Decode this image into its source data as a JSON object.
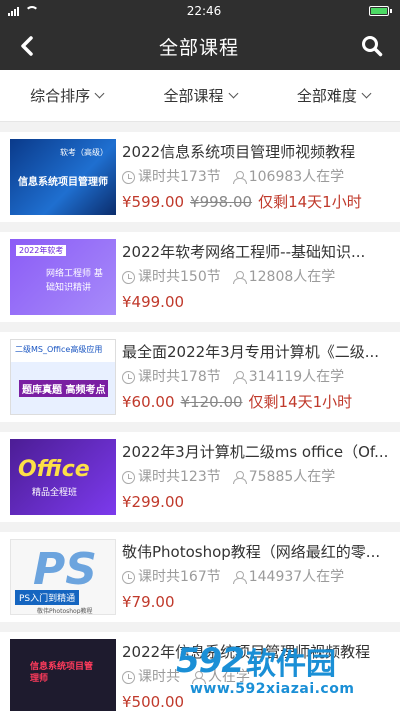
{
  "status_bar": {
    "time": "22:46"
  },
  "header": {
    "title": "全部课程"
  },
  "filters": [
    {
      "label": "综合排序"
    },
    {
      "label": "全部课程"
    },
    {
      "label": "全部难度"
    }
  ],
  "courses": [
    {
      "title": "2022信息系统项目管理师视频教程",
      "lessons": "课时共173节",
      "students": "106983人在学",
      "price": "¥599.00",
      "original_price": "¥998.00",
      "countdown": "仅剩14天1小时",
      "thumb_text": "信息系统项目管理师",
      "thumb_tag": "软考（高级）"
    },
    {
      "title": "2022年软考网络工程师--基础知识...",
      "lessons": "课时共150节",
      "students": "12808人在学",
      "price": "¥499.00",
      "original_price": "",
      "countdown": "",
      "thumb_text": "网络工程师 基础知识精讲",
      "thumb_tag": "2022年软考"
    },
    {
      "title": "最全面2022年3月专用计算机《二级...",
      "lessons": "课时共178节",
      "students": "314119人在学",
      "price": "¥60.00",
      "original_price": "¥120.00",
      "countdown": "仅剩14天1小时",
      "thumb_text": "题库真题 高频考点",
      "thumb_tag": "二级MS_Office高级应用"
    },
    {
      "title": "2022年3月计算机二级ms office（Of...",
      "lessons": "课时共123节",
      "students": "75885人在学",
      "price": "¥299.00",
      "original_price": "",
      "countdown": "",
      "thumb_text": "Office",
      "thumb_tag": "精品全程班"
    },
    {
      "title": "敬伟Photoshop教程（网络最红的零...",
      "lessons": "课时共167节",
      "students": "144937人在学",
      "price": "¥79.00",
      "original_price": "",
      "countdown": "",
      "thumb_text": "PS入门到精通",
      "thumb_tag": "敬伟Photoshop教程"
    },
    {
      "title": "2022年信息系统项目管理师视频教程",
      "lessons": "课时共",
      "students": "人在学",
      "price": "¥500.00",
      "original_price": "",
      "countdown": "",
      "thumb_text": "信息系统项目管理师",
      "thumb_tag": ""
    }
  ],
  "watermark": {
    "logo_num": "592",
    "logo_text": "软件园",
    "url": "www.592xiazai.com"
  }
}
